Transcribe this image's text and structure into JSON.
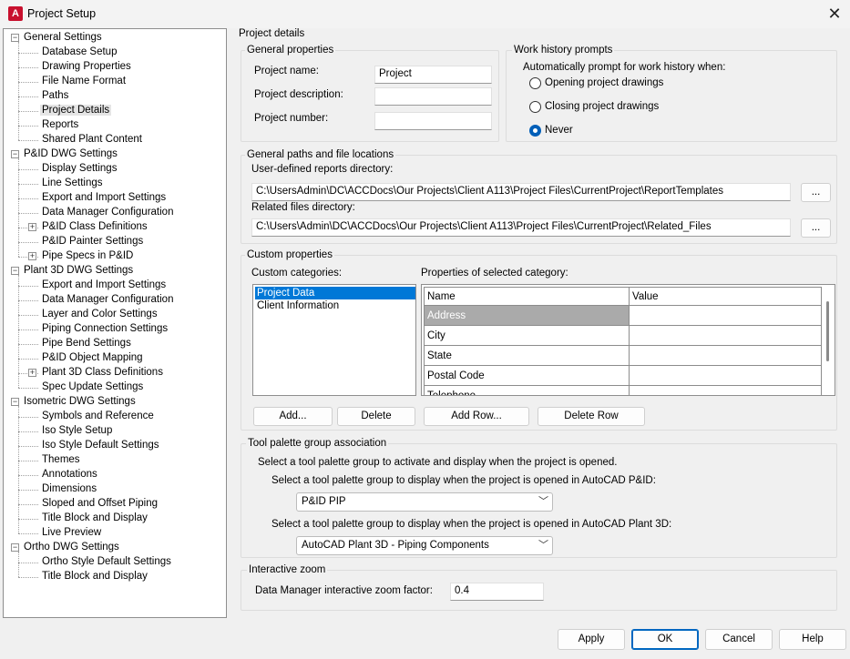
{
  "window": {
    "title": "Project Setup",
    "app_icon_letter": "A"
  },
  "tree": [
    {
      "label": "General Settings",
      "level": 0,
      "expander": "minus"
    },
    {
      "label": "Database Setup",
      "level": 1
    },
    {
      "label": "Drawing Properties",
      "level": 1
    },
    {
      "label": "File Name Format",
      "level": 1
    },
    {
      "label": "Paths",
      "level": 1
    },
    {
      "label": "Project Details",
      "level": 1,
      "selected": true
    },
    {
      "label": "Reports",
      "level": 1
    },
    {
      "label": "Shared Plant Content",
      "level": 1
    },
    {
      "label": "P&ID DWG Settings",
      "level": 0,
      "expander": "minus"
    },
    {
      "label": "Display Settings",
      "level": 1
    },
    {
      "label": "Line Settings",
      "level": 1
    },
    {
      "label": "Export and Import Settings",
      "level": 1
    },
    {
      "label": "Data Manager Configuration",
      "level": 1
    },
    {
      "label": "P&ID Class Definitions",
      "level": 1,
      "expander": "plus"
    },
    {
      "label": "P&ID Painter Settings",
      "level": 1
    },
    {
      "label": "Pipe Specs in P&ID",
      "level": 1,
      "expander": "plus"
    },
    {
      "label": "Plant 3D DWG Settings",
      "level": 0,
      "expander": "minus"
    },
    {
      "label": "Export and Import Settings",
      "level": 1
    },
    {
      "label": "Data Manager Configuration",
      "level": 1
    },
    {
      "label": "Layer and Color Settings",
      "level": 1
    },
    {
      "label": "Piping Connection Settings",
      "level": 1
    },
    {
      "label": "Pipe Bend Settings",
      "level": 1
    },
    {
      "label": "P&ID Object Mapping",
      "level": 1
    },
    {
      "label": "Plant 3D Class Definitions",
      "level": 1,
      "expander": "plus"
    },
    {
      "label": "Spec Update Settings",
      "level": 1
    },
    {
      "label": "Isometric DWG Settings",
      "level": 0,
      "expander": "minus"
    },
    {
      "label": "Symbols and Reference",
      "level": 1
    },
    {
      "label": "Iso Style Setup",
      "level": 1
    },
    {
      "label": "Iso Style Default Settings",
      "level": 1
    },
    {
      "label": "Themes",
      "level": 1
    },
    {
      "label": "Annotations",
      "level": 1
    },
    {
      "label": "Dimensions",
      "level": 1
    },
    {
      "label": "Sloped and Offset Piping",
      "level": 1
    },
    {
      "label": "Title Block and Display",
      "level": 1
    },
    {
      "label": "Live Preview",
      "level": 1
    },
    {
      "label": "Ortho DWG Settings",
      "level": 0,
      "expander": "minus"
    },
    {
      "label": "Ortho Style Default Settings",
      "level": 1
    },
    {
      "label": "Title Block and Display",
      "level": 1
    }
  ],
  "panel": {
    "heading": "Project details",
    "general": {
      "title": "General properties",
      "name_label": "Project name:",
      "name_value": "Project",
      "desc_label": "Project description:",
      "desc_value": "",
      "number_label": "Project number:",
      "number_value": ""
    },
    "work_history": {
      "title": "Work history prompts",
      "prompt": "Automatically prompt for work history when:",
      "options": [
        "Opening project drawings",
        "Closing project drawings",
        "Never"
      ],
      "selected": "Never"
    },
    "paths": {
      "title": "General paths and file locations",
      "reports_label": "User-defined reports directory:",
      "reports_value": "C:\\UsersAdmin\\DC\\ACCDocs\\Our Projects\\Client A113\\Project Files\\CurrentProject\\ReportTemplates",
      "related_label": "Related files directory:",
      "related_value": "C:\\Users\\Admin\\DC\\ACCDocs\\Our Projects\\Client A113\\Project Files\\CurrentProject\\Related_Files",
      "browse_label": "..."
    },
    "custom": {
      "title": "Custom properties",
      "categories_label": "Custom categories:",
      "categories": [
        "Project Data",
        "Client Information"
      ],
      "selected_category": "Project Data",
      "props_label": "Properties of selected category:",
      "columns": [
        "Name",
        "Value"
      ],
      "rows": [
        {
          "name": "Address",
          "value": ""
        },
        {
          "name": "City",
          "value": ""
        },
        {
          "name": "State",
          "value": ""
        },
        {
          "name": "Postal Code",
          "value": ""
        },
        {
          "name": "Telephone",
          "value": ""
        }
      ],
      "buttons": {
        "add": "Add...",
        "delete": "Delete",
        "add_row": "Add Row...",
        "delete_row": "Delete Row"
      }
    },
    "palette": {
      "title": "Tool palette group association",
      "intro": "Select a tool palette group to activate and display when the project is opened.",
      "pid_label": "Select a tool palette group to display when the project is opened in AutoCAD P&ID:",
      "pid_value": "P&ID PIP",
      "plant_label": "Select a tool palette group to display when the project is opened in AutoCAD Plant 3D:",
      "plant_value": "AutoCAD Plant 3D - Piping Components"
    },
    "zoom": {
      "title": "Interactive zoom",
      "label": "Data Manager interactive zoom factor:",
      "value": "0.4"
    }
  },
  "footer": {
    "apply": "Apply",
    "ok": "OK",
    "cancel": "Cancel",
    "help": "Help"
  },
  "colors": {
    "selection": "#0078d7",
    "primary_border": "#0067c0",
    "highlight_cell": "#aaaaaa",
    "app_icon": "#c8102e"
  }
}
